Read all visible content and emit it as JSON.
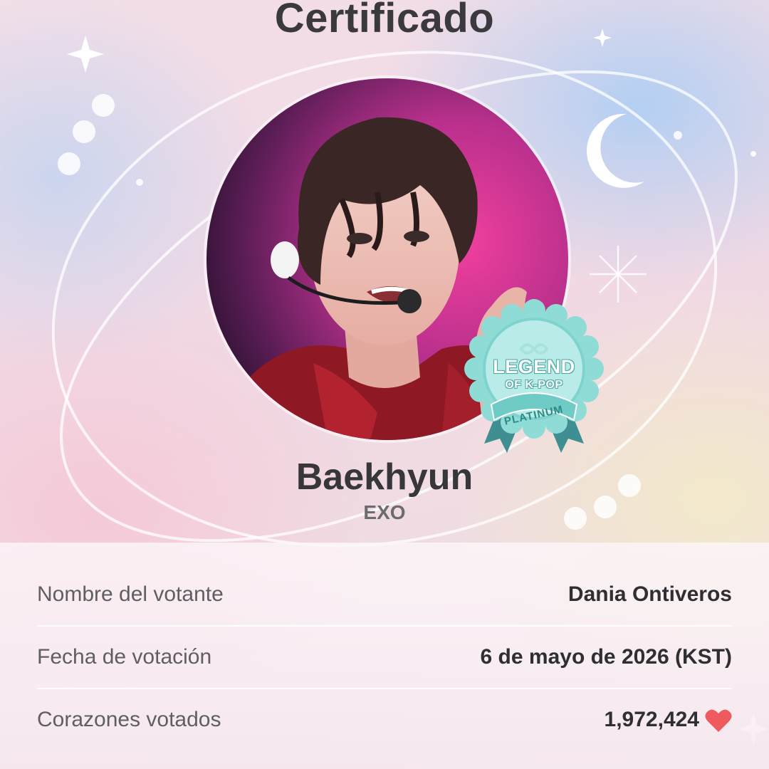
{
  "header": {
    "title": "Certificado"
  },
  "artist": {
    "name": "Baekhyun",
    "group": "EXO"
  },
  "badge": {
    "line1": "LEGEND",
    "line2": "OF K-POP",
    "tier": "PLATINUM",
    "color": "#7fd3cf",
    "ribbon_color": "#3f8f92"
  },
  "details": {
    "voter": {
      "label": "Nombre del votante",
      "value": "Dania Ontiveros"
    },
    "date": {
      "label": "Fecha de votación",
      "value": "6 de mayo de 2026 (KST)"
    },
    "hearts": {
      "label": "Corazones votados",
      "value": "1,972,424",
      "icon": "heart-icon",
      "icon_color": "#ee5a5e"
    }
  }
}
